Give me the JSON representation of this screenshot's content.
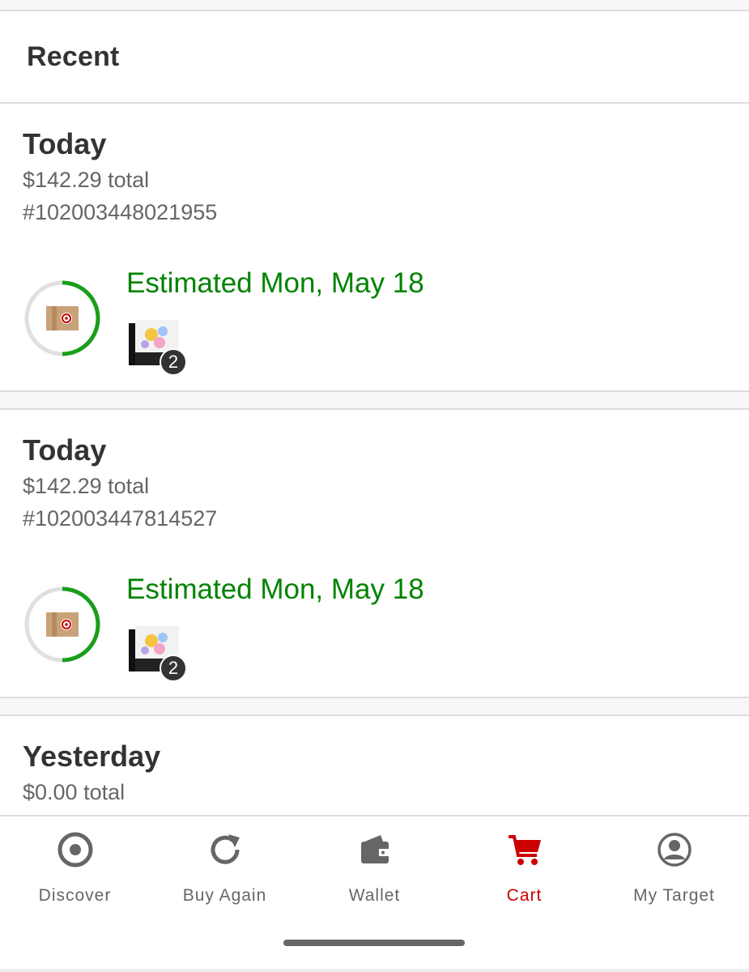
{
  "section": {
    "title": "Recent"
  },
  "orders": [
    {
      "date": "Today",
      "total": "$142.29 total",
      "number": "#102003448021955",
      "estimate": "Estimated Mon, May 18",
      "quantity": "2",
      "progress": 0.5
    },
    {
      "date": "Today",
      "total": "$142.29 total",
      "number": "#102003447814527",
      "estimate": "Estimated Mon, May 18",
      "quantity": "2",
      "progress": 0.5
    },
    {
      "date": "Yesterday",
      "total": "$0.00 total"
    }
  ],
  "tabs": [
    {
      "label": "Discover",
      "icon": "target-logo-icon"
    },
    {
      "label": "Buy Again",
      "icon": "refresh-icon"
    },
    {
      "label": "Wallet",
      "icon": "wallet-icon"
    },
    {
      "label": "Cart",
      "icon": "cart-icon",
      "active": true
    },
    {
      "label": "My Target",
      "icon": "account-icon"
    }
  ],
  "colors": {
    "accent": "#cc0000",
    "estimate_green": "#008300",
    "progress_green": "#1a9e1a",
    "text_dark": "#333333",
    "text_muted": "#666666"
  }
}
